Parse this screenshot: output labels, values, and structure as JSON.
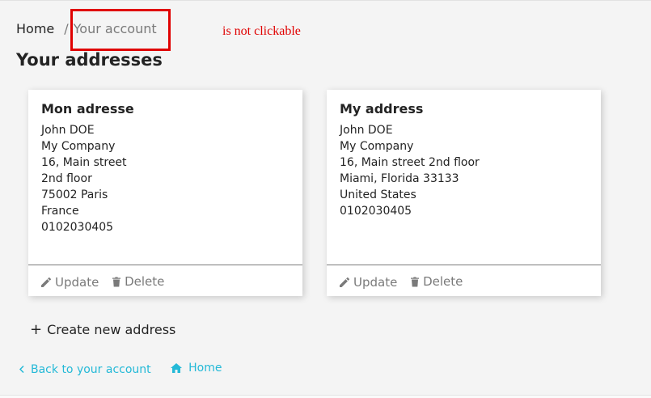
{
  "breadcrumb": {
    "home": "Home",
    "separator": "/",
    "current": "Your account"
  },
  "annotation": {
    "text": "is not clickable",
    "color": "#e00000"
  },
  "page": {
    "title": "Your addresses"
  },
  "addresses": [
    {
      "alias": "Mon adresse",
      "lines": [
        "John DOE",
        "My Company",
        "16, Main street",
        "2nd floor",
        "75002 Paris",
        "France",
        "0102030405"
      ],
      "update_label": "Update",
      "delete_label": "Delete"
    },
    {
      "alias": "My address",
      "lines": [
        "John DOE",
        "My Company",
        "16, Main street 2nd floor",
        "Miami, Florida 33133",
        "United States",
        "0102030405"
      ],
      "update_label": "Update",
      "delete_label": "Delete"
    }
  ],
  "actions": {
    "create_prefix": "+",
    "create_label": "Create new address"
  },
  "footer": {
    "back_label": "Back to your account",
    "home_label": "Home"
  },
  "colors": {
    "link": "#24b9d7",
    "muted": "#7a7a7a",
    "text": "#232323"
  }
}
